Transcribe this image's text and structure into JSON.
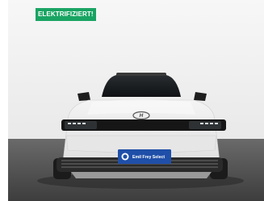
{
  "badge": {
    "label": "ELEKTRIFIZIERT!",
    "color": "#19a463"
  },
  "license_plate": {
    "text": "Emil Frey Select",
    "color": "#1f4fa8"
  },
  "photo": {
    "subject": "car-front-view",
    "car_color": "#ededed",
    "floor_color": "#525252"
  }
}
